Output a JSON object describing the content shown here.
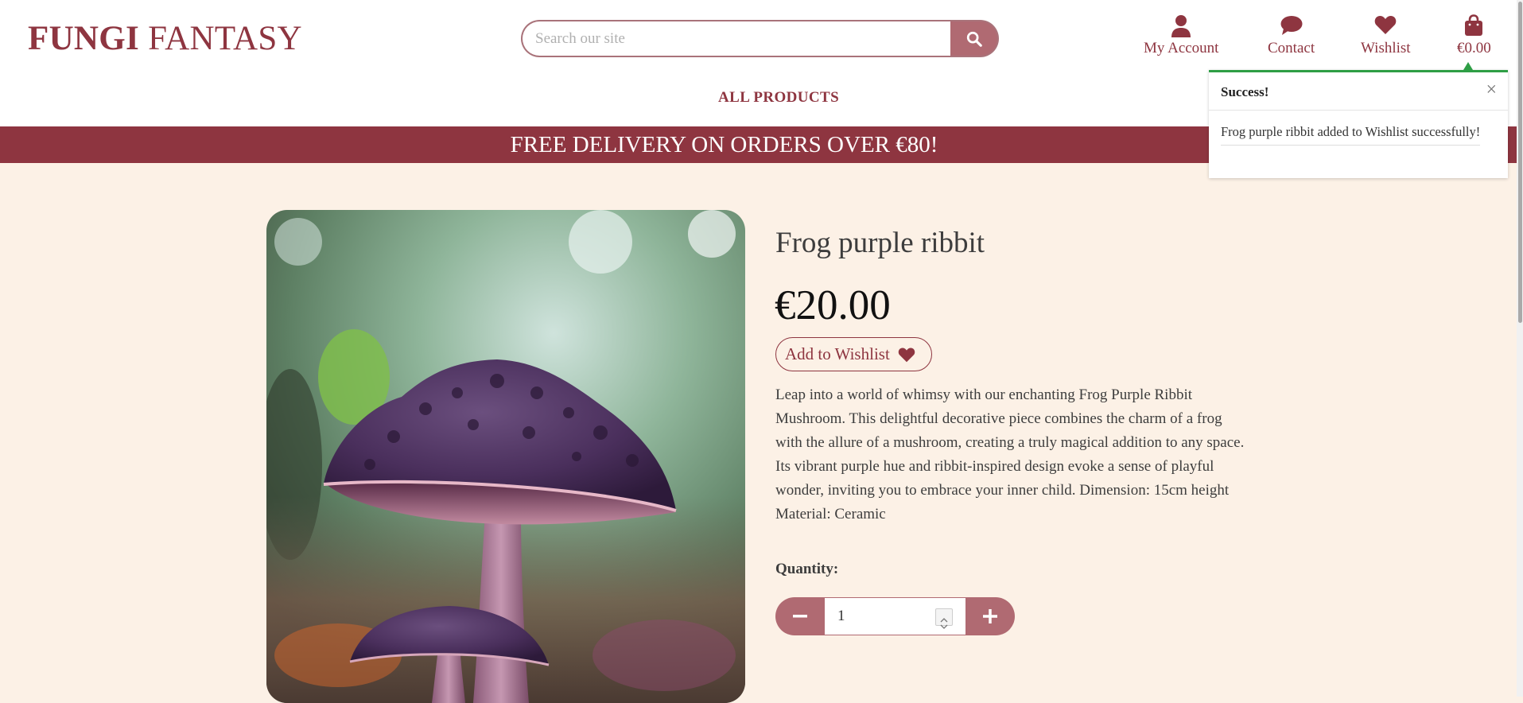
{
  "header": {
    "logo_bold": "FUNGI",
    "logo_rest": " FANTASY",
    "search_placeholder": "Search our site",
    "nav": {
      "account": "My Account",
      "contact": "Contact",
      "wishlist": "Wishlist",
      "cart": "€0.00"
    },
    "all_products": "ALL PRODUCTS"
  },
  "banner": "FREE DELIVERY ON ORDERS OVER €80!",
  "toast": {
    "title": "Success!",
    "message": "Frog purple ribbit added to Wishlist successfully!",
    "close": "×"
  },
  "product": {
    "title": "Frog purple ribbit",
    "price": "€20.00",
    "wishlist_button": "Add to Wishlist",
    "description": "Leap into a world of whimsy with our enchanting Frog Purple Ribbit Mushroom. This delightful decorative piece combines the charm of a frog with the allure of a mushroom, creating a truly magical addition to any space. Its vibrant purple hue and ribbit-inspired design evoke a sense of playful wonder, inviting you to embrace your inner child. Dimension: 15cm height Material: Ceramic",
    "quantity_label": "Quantity:",
    "quantity_value": "1"
  },
  "colors": {
    "brand": "#8e3540",
    "button": "#b06a72",
    "background": "#fcf1e6",
    "success": "#2e9e45"
  },
  "icons": [
    "search-icon",
    "user-icon",
    "chat-icon",
    "heart-icon",
    "shopping-bag-icon",
    "close-icon",
    "minus-icon",
    "plus-icon"
  ]
}
